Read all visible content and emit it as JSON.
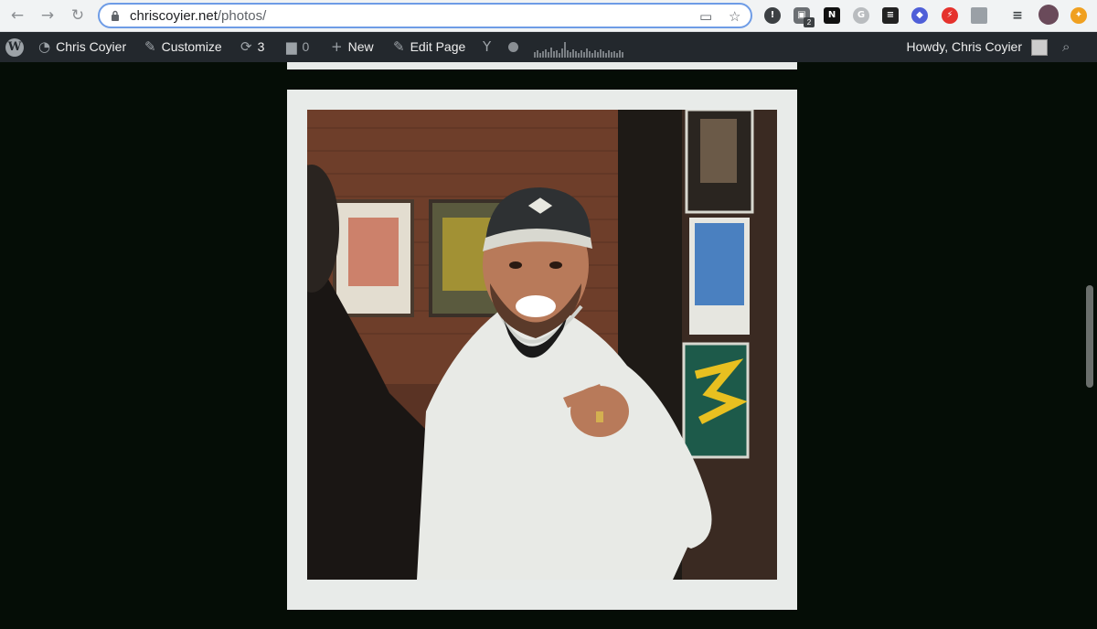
{
  "browser": {
    "url_host": "chriscoyier.net",
    "url_path": "/photos/",
    "extension_badge": "2"
  },
  "admin_bar": {
    "site_name": "Chris Coyier",
    "customize": "Customize",
    "updates_count": "3",
    "comments_count": "0",
    "new_label": "New",
    "edit_page": "Edit Page",
    "howdy": "Howdy, Chris Coyier"
  },
  "colors": {
    "page_background": "#050d06",
    "frame": "#e8ebe9",
    "admin_bar": "#23282d"
  },
  "photo": {
    "subject": "man in cap and white hoodie pointing at camera"
  }
}
